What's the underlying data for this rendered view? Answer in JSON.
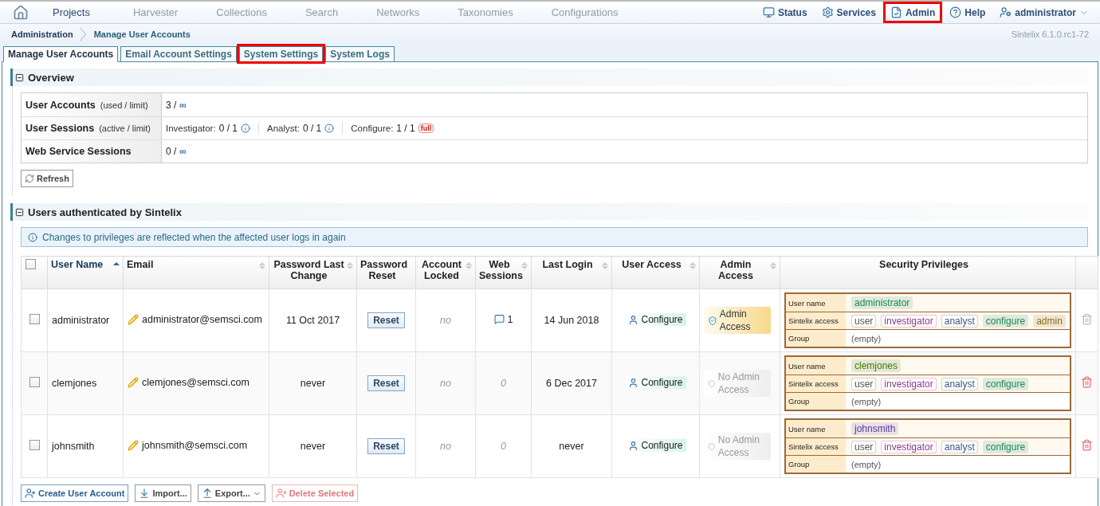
{
  "top_nav": {
    "items": [
      {
        "label": "Projects",
        "disabled": false
      },
      {
        "label": "Harvester",
        "disabled": true
      },
      {
        "label": "Collections",
        "disabled": true
      },
      {
        "label": "Search",
        "disabled": true
      },
      {
        "label": "Networks",
        "disabled": true
      },
      {
        "label": "Taxonomies",
        "disabled": true
      },
      {
        "label": "Configurations",
        "disabled": true
      }
    ],
    "right_items": [
      {
        "kind": "status",
        "label": "Status",
        "highlighted": false
      },
      {
        "kind": "services",
        "label": "Services",
        "highlighted": false
      },
      {
        "kind": "admin",
        "label": "Admin",
        "highlighted": true
      },
      {
        "kind": "help",
        "label": "Help",
        "highlighted": false
      },
      {
        "kind": "user",
        "label": "administrator",
        "highlighted": false
      }
    ]
  },
  "breadcrumb": [
    "Administration",
    "Manage User Accounts"
  ],
  "version": "Sintelix 6.1.0.rc1-72",
  "tabs": [
    {
      "label": "Manage User Accounts",
      "selected": true,
      "highlighted": false
    },
    {
      "label": "Email Account Settings",
      "selected": false,
      "highlighted": false
    },
    {
      "label": "System Settings",
      "selected": false,
      "highlighted": true
    },
    {
      "label": "System Logs",
      "selected": false,
      "highlighted": false
    }
  ],
  "overview": {
    "title": "Overview",
    "expanded": true,
    "rows": [
      {
        "label": "User Accounts",
        "hint": "(used / limit)",
        "items": [
          {
            "kind": "ratio",
            "value": "3 /",
            "limit": "∞"
          }
        ]
      },
      {
        "label": "User Sessions",
        "hint": "(active / limit)",
        "items": [
          {
            "kind": "info",
            "label": "Investigator:",
            "value": "0 / 1"
          },
          {
            "kind": "info",
            "label": "Analyst:",
            "value": "0 / 1"
          },
          {
            "kind": "full",
            "label": "Configure:",
            "value": "1 / 1",
            "tag": "full"
          }
        ]
      },
      {
        "label": "Web Service Sessions",
        "items": [
          {
            "kind": "ratio",
            "value": "0 /",
            "limit": "∞"
          }
        ]
      }
    ],
    "refresh_button": "Refresh"
  },
  "users_section": {
    "title": "Users authenticated by Sintelix",
    "expanded": true,
    "notice": "Changes to privileges are reflected when the affected user logs in again",
    "select_all": {
      "checked": false
    },
    "columns": [
      {
        "label": "User Name",
        "sortable": true,
        "sorted": true
      },
      {
        "label": "Email",
        "sortable": true,
        "sorted": false
      },
      {
        "label": "Password Last Change",
        "sortable": true,
        "sorted": false
      },
      {
        "label": "Password Reset",
        "sortable": false,
        "sorted": false
      },
      {
        "label": "Account Locked",
        "sortable": true,
        "sorted": false
      },
      {
        "label": "Web Sessions",
        "sortable": true,
        "sorted": false
      },
      {
        "label": "Last Login",
        "sortable": true,
        "sorted": false
      },
      {
        "label": "User Access",
        "sortable": true,
        "sorted": false
      },
      {
        "label": "Admin Access",
        "sortable": true,
        "sorted": false
      },
      {
        "label": "Security Privileges",
        "sortable": false,
        "sorted": false
      }
    ],
    "rows": [
      {
        "checked": false,
        "user_name": "administrator",
        "email": "administrator@semsci.com",
        "password_last_change": "11 Oct 2017",
        "password_reset": "Reset",
        "account_locked": "no",
        "web_sessions": {
          "value": "1",
          "active": true
        },
        "last_login": "14 Jun 2018",
        "user_access": "Configure",
        "admin_access": {
          "label": "Admin Access",
          "granted": true
        },
        "privileges": [
          {
            "label": "User name",
            "tags": [
              {
                "text": "administrator",
                "color": "#1a8a5a",
                "filled": true
              }
            ]
          },
          {
            "label": "Sintelix access",
            "tags": [
              {
                "text": "user",
                "color": "#555555",
                "filled": false
              },
              {
                "text": "investigator",
                "color": "#8a3a8a",
                "filled": false
              },
              {
                "text": "analyst",
                "color": "#3a5a7a",
                "filled": false
              },
              {
                "text": "configure",
                "color": "#1a8a5a",
                "filled": true
              },
              {
                "text": "admin",
                "color": "#8a6a1a",
                "filled": true
              }
            ]
          },
          {
            "label": "Group",
            "value": "(empty)"
          }
        ],
        "delete_disabled": true
      },
      {
        "checked": false,
        "user_name": "clemjones",
        "email": "clemjones@semsci.com",
        "password_last_change": "never",
        "password_reset": "Reset",
        "account_locked": "no",
        "web_sessions": {
          "value": "0",
          "active": false
        },
        "last_login": "6 Dec 2017",
        "user_access": "Configure",
        "admin_access": {
          "label": "No Admin Access",
          "granted": false
        },
        "privileges": [
          {
            "label": "User name",
            "tags": [
              {
                "text": "clemjones",
                "color": "#3f7a10",
                "filled": true
              }
            ]
          },
          {
            "label": "Sintelix access",
            "tags": [
              {
                "text": "user",
                "color": "#555555",
                "filled": false
              },
              {
                "text": "investigator",
                "color": "#8a3a8a",
                "filled": false
              },
              {
                "text": "analyst",
                "color": "#3a5a7a",
                "filled": false
              },
              {
                "text": "configure",
                "color": "#1a8a5a",
                "filled": true
              }
            ]
          },
          {
            "label": "Group",
            "value": "(empty)"
          }
        ],
        "delete_disabled": false
      },
      {
        "checked": false,
        "user_name": "johnsmith",
        "email": "johnsmith@semsci.com",
        "password_last_change": "never",
        "password_reset": "Reset",
        "account_locked": "no",
        "web_sessions": {
          "value": "0",
          "active": false
        },
        "last_login": "never",
        "user_access": "Configure",
        "admin_access": {
          "label": "No Admin Access",
          "granted": false
        },
        "privileges": [
          {
            "label": "User name",
            "tags": [
              {
                "text": "johnsmith",
                "color": "#5a3a9a",
                "filled": true
              }
            ]
          },
          {
            "label": "Sintelix access",
            "tags": [
              {
                "text": "user",
                "color": "#555555",
                "filled": false
              },
              {
                "text": "investigator",
                "color": "#8a3a8a",
                "filled": false
              },
              {
                "text": "analyst",
                "color": "#3a5a7a",
                "filled": false
              },
              {
                "text": "configure",
                "color": "#1a8a5a",
                "filled": true
              }
            ]
          },
          {
            "label": "Group",
            "value": "(empty)"
          }
        ],
        "delete_disabled": false
      }
    ],
    "buttons": [
      {
        "kind": "create",
        "label": "Create User Account",
        "disabled": false
      },
      {
        "kind": "import",
        "label": "Import...",
        "disabled": false
      },
      {
        "kind": "export",
        "label": "Export...",
        "disabled": false
      },
      {
        "kind": "delete",
        "label": "Delete Selected",
        "disabled": true
      }
    ]
  }
}
